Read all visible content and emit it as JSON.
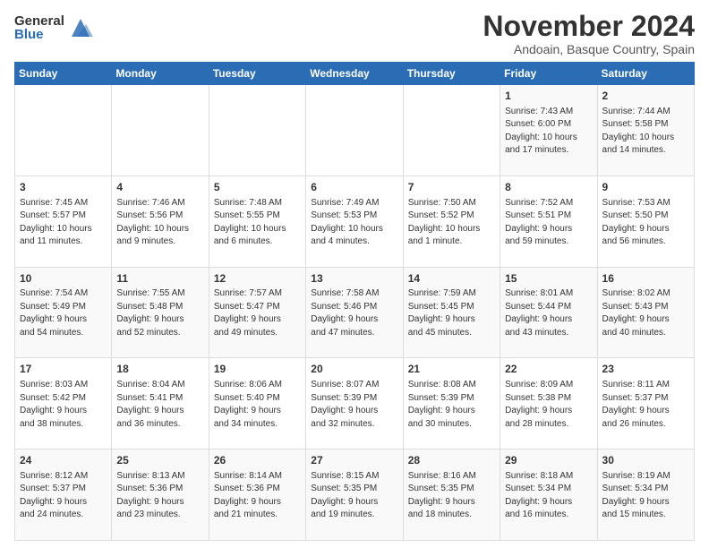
{
  "logo": {
    "general": "General",
    "blue": "Blue"
  },
  "title": "November 2024",
  "subtitle": "Andoain, Basque Country, Spain",
  "headers": [
    "Sunday",
    "Monday",
    "Tuesday",
    "Wednesday",
    "Thursday",
    "Friday",
    "Saturday"
  ],
  "rows": [
    [
      {
        "day": "",
        "info": ""
      },
      {
        "day": "",
        "info": ""
      },
      {
        "day": "",
        "info": ""
      },
      {
        "day": "",
        "info": ""
      },
      {
        "day": "",
        "info": ""
      },
      {
        "day": "1",
        "info": "Sunrise: 7:43 AM\nSunset: 6:00 PM\nDaylight: 10 hours\nand 17 minutes."
      },
      {
        "day": "2",
        "info": "Sunrise: 7:44 AM\nSunset: 5:58 PM\nDaylight: 10 hours\nand 14 minutes."
      }
    ],
    [
      {
        "day": "3",
        "info": "Sunrise: 7:45 AM\nSunset: 5:57 PM\nDaylight: 10 hours\nand 11 minutes."
      },
      {
        "day": "4",
        "info": "Sunrise: 7:46 AM\nSunset: 5:56 PM\nDaylight: 10 hours\nand 9 minutes."
      },
      {
        "day": "5",
        "info": "Sunrise: 7:48 AM\nSunset: 5:55 PM\nDaylight: 10 hours\nand 6 minutes."
      },
      {
        "day": "6",
        "info": "Sunrise: 7:49 AM\nSunset: 5:53 PM\nDaylight: 10 hours\nand 4 minutes."
      },
      {
        "day": "7",
        "info": "Sunrise: 7:50 AM\nSunset: 5:52 PM\nDaylight: 10 hours\nand 1 minute."
      },
      {
        "day": "8",
        "info": "Sunrise: 7:52 AM\nSunset: 5:51 PM\nDaylight: 9 hours\nand 59 minutes."
      },
      {
        "day": "9",
        "info": "Sunrise: 7:53 AM\nSunset: 5:50 PM\nDaylight: 9 hours\nand 56 minutes."
      }
    ],
    [
      {
        "day": "10",
        "info": "Sunrise: 7:54 AM\nSunset: 5:49 PM\nDaylight: 9 hours\nand 54 minutes."
      },
      {
        "day": "11",
        "info": "Sunrise: 7:55 AM\nSunset: 5:48 PM\nDaylight: 9 hours\nand 52 minutes."
      },
      {
        "day": "12",
        "info": "Sunrise: 7:57 AM\nSunset: 5:47 PM\nDaylight: 9 hours\nand 49 minutes."
      },
      {
        "day": "13",
        "info": "Sunrise: 7:58 AM\nSunset: 5:46 PM\nDaylight: 9 hours\nand 47 minutes."
      },
      {
        "day": "14",
        "info": "Sunrise: 7:59 AM\nSunset: 5:45 PM\nDaylight: 9 hours\nand 45 minutes."
      },
      {
        "day": "15",
        "info": "Sunrise: 8:01 AM\nSunset: 5:44 PM\nDaylight: 9 hours\nand 43 minutes."
      },
      {
        "day": "16",
        "info": "Sunrise: 8:02 AM\nSunset: 5:43 PM\nDaylight: 9 hours\nand 40 minutes."
      }
    ],
    [
      {
        "day": "17",
        "info": "Sunrise: 8:03 AM\nSunset: 5:42 PM\nDaylight: 9 hours\nand 38 minutes."
      },
      {
        "day": "18",
        "info": "Sunrise: 8:04 AM\nSunset: 5:41 PM\nDaylight: 9 hours\nand 36 minutes."
      },
      {
        "day": "19",
        "info": "Sunrise: 8:06 AM\nSunset: 5:40 PM\nDaylight: 9 hours\nand 34 minutes."
      },
      {
        "day": "20",
        "info": "Sunrise: 8:07 AM\nSunset: 5:39 PM\nDaylight: 9 hours\nand 32 minutes."
      },
      {
        "day": "21",
        "info": "Sunrise: 8:08 AM\nSunset: 5:39 PM\nDaylight: 9 hours\nand 30 minutes."
      },
      {
        "day": "22",
        "info": "Sunrise: 8:09 AM\nSunset: 5:38 PM\nDaylight: 9 hours\nand 28 minutes."
      },
      {
        "day": "23",
        "info": "Sunrise: 8:11 AM\nSunset: 5:37 PM\nDaylight: 9 hours\nand 26 minutes."
      }
    ],
    [
      {
        "day": "24",
        "info": "Sunrise: 8:12 AM\nSunset: 5:37 PM\nDaylight: 9 hours\nand 24 minutes."
      },
      {
        "day": "25",
        "info": "Sunrise: 8:13 AM\nSunset: 5:36 PM\nDaylight: 9 hours\nand 23 minutes."
      },
      {
        "day": "26",
        "info": "Sunrise: 8:14 AM\nSunset: 5:36 PM\nDaylight: 9 hours\nand 21 minutes."
      },
      {
        "day": "27",
        "info": "Sunrise: 8:15 AM\nSunset: 5:35 PM\nDaylight: 9 hours\nand 19 minutes."
      },
      {
        "day": "28",
        "info": "Sunrise: 8:16 AM\nSunset: 5:35 PM\nDaylight: 9 hours\nand 18 minutes."
      },
      {
        "day": "29",
        "info": "Sunrise: 8:18 AM\nSunset: 5:34 PM\nDaylight: 9 hours\nand 16 minutes."
      },
      {
        "day": "30",
        "info": "Sunrise: 8:19 AM\nSunset: 5:34 PM\nDaylight: 9 hours\nand 15 minutes."
      }
    ]
  ]
}
